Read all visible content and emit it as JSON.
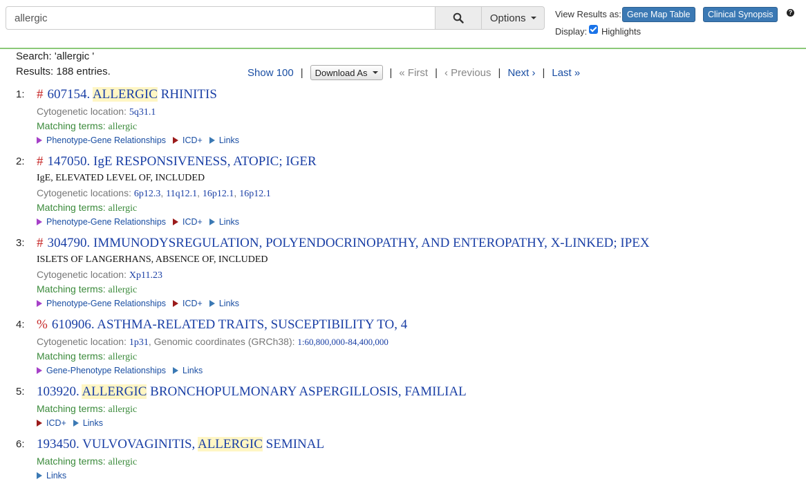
{
  "search": {
    "value": "allergic",
    "options_label": "Options"
  },
  "view": {
    "label": "View Results as:",
    "gene_map_table": "Gene Map Table",
    "clinical_synopsis": "Clinical Synopsis",
    "display_label": "Display:",
    "highlights_label": "Highlights",
    "highlights_checked": true
  },
  "summary": {
    "search_text": "Search: 'allergic '",
    "results_text": "Results: 188 entries."
  },
  "pager": {
    "show": "Show 100",
    "download": "Download As",
    "first": "« First",
    "previous": "‹ Previous",
    "next": "Next ›",
    "last": "Last »"
  },
  "entries": [
    {
      "num": "1:",
      "symbol": "#",
      "id": "607154.",
      "title_pre": "",
      "highlight": "ALLERGIC",
      "title_post": "RHINITIS",
      "cyto_label": "Cytogenetic location:",
      "cyto_values": [
        "5q31.1"
      ],
      "match_label": "Matching terms:",
      "match_term": "allergic",
      "links": [
        "Phenotype-Gene Relationships",
        "ICD+",
        "Links"
      ]
    },
    {
      "num": "2:",
      "symbol": "#",
      "id": "147050.",
      "title": "IgE RESPONSIVENESS, ATOPIC; IGER",
      "sub": "IgE, ELEVATED LEVEL OF, INCLUDED",
      "cyto_label": "Cytogenetic locations:",
      "cyto_values": [
        "6p12.3",
        "11q12.1",
        "16p12.1",
        "16p12.1"
      ],
      "match_label": "Matching terms:",
      "match_term": "allergic",
      "links": [
        "Phenotype-Gene Relationships",
        "ICD+",
        "Links"
      ]
    },
    {
      "num": "3:",
      "symbol": "#",
      "id": "304790.",
      "title": "IMMUNODYSREGULATION, POLYENDOCRINOPATHY, AND ENTEROPATHY, X-LINKED; IPEX",
      "sub": "ISLETS OF LANGERHANS, ABSENCE OF, INCLUDED",
      "cyto_label": "Cytogenetic location:",
      "cyto_values": [
        "Xp11.23"
      ],
      "match_label": "Matching terms:",
      "match_term": "allergic",
      "links": [
        "Phenotype-Gene Relationships",
        "ICD+",
        "Links"
      ]
    },
    {
      "num": "4:",
      "symbol": "%",
      "id": "610906.",
      "title": "ASTHMA-RELATED TRAITS, SUSCEPTIBILITY TO, 4",
      "cyto_label": "Cytogenetic location:",
      "cyto_values": [
        "1p31"
      ],
      "genomic_label": "Genomic coordinates (GRCh38):",
      "genomic_value": "1:60,800,000-84,400,000",
      "match_label": "Matching terms:",
      "match_term": "allergic",
      "links": [
        "Gene-Phenotype Relationships",
        "Links"
      ]
    },
    {
      "num": "5:",
      "id": "103920.",
      "highlight": "ALLERGIC",
      "title_post": "BRONCHOPULMONARY ASPERGILLOSIS, FAMILIAL",
      "match_label": "Matching terms:",
      "match_term": "allergic",
      "links": [
        "ICD+",
        "Links"
      ]
    },
    {
      "num": "6:",
      "id": "193450.",
      "title_pre": "VULVOVAGINITIS,",
      "highlight": "ALLERGIC",
      "title_post": "SEMINAL",
      "match_label": "Matching terms:",
      "match_term": "allergic",
      "links": [
        "Links"
      ]
    }
  ],
  "colors": {
    "accent_green": "#8bc878",
    "button_blue": "#3b79b4",
    "link_blue": "#1a3fa5",
    "match_green": "#3a8a3a",
    "symbol_red": "#c62828",
    "highlight": "#fff6c4"
  }
}
